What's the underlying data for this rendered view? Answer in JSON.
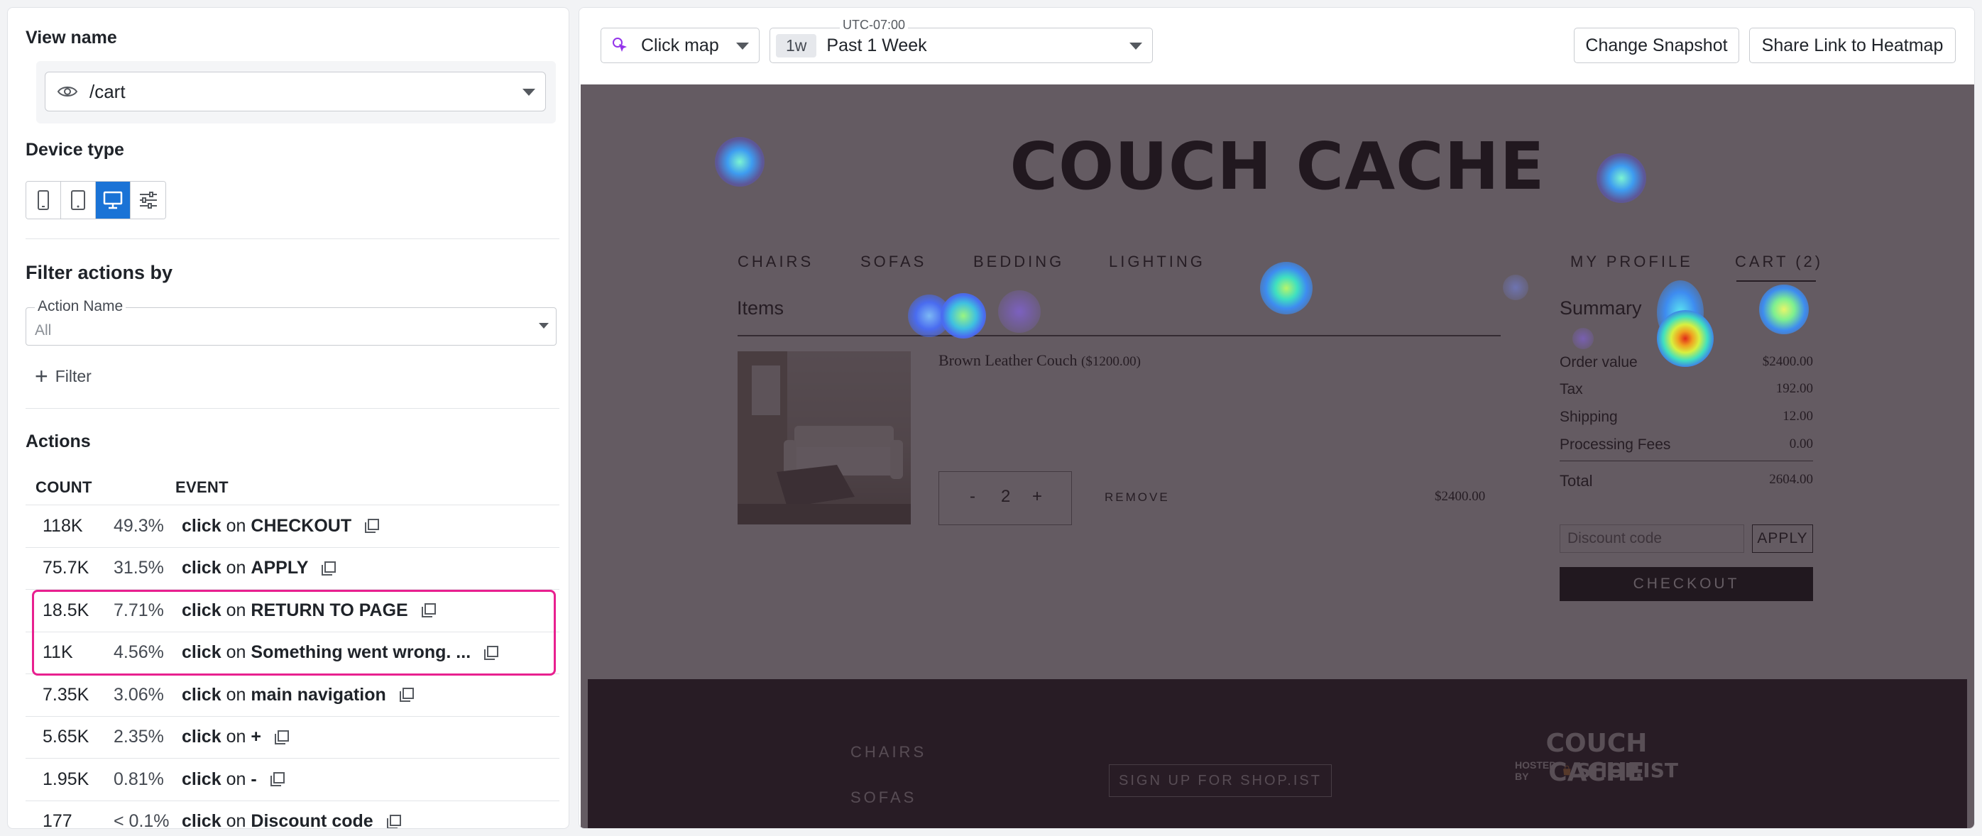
{
  "sidebar": {
    "view_name_title": "View name",
    "view_value": "/cart",
    "device_type_title": "Device type",
    "devices": [
      {
        "icon": "mobile-icon",
        "active": false
      },
      {
        "icon": "tablet-icon",
        "active": false
      },
      {
        "icon": "desktop-icon",
        "active": true
      },
      {
        "icon": "sliders-icon",
        "active": false
      }
    ],
    "filter_title": "Filter actions by",
    "action_name_label": "Action Name",
    "action_name_value": "All",
    "filter_button": "Filter",
    "actions_title": "Actions",
    "col_count": "COUNT",
    "col_event": "EVENT",
    "rows": [
      {
        "count": "118K",
        "pct": "49.3%",
        "verb": "click",
        "on": "on",
        "target": "CHECKOUT"
      },
      {
        "count": "75.7K",
        "pct": "31.5%",
        "verb": "click",
        "on": "on",
        "target": "APPLY"
      },
      {
        "count": "18.5K",
        "pct": "7.71%",
        "verb": "click",
        "on": "on",
        "target": "RETURN TO PAGE"
      },
      {
        "count": "11K",
        "pct": "4.56%",
        "verb": "click",
        "on": "on",
        "target": "Something went wrong. ..."
      },
      {
        "count": "7.35K",
        "pct": "3.06%",
        "verb": "click",
        "on": "on",
        "target": "main navigation"
      },
      {
        "count": "5.65K",
        "pct": "2.35%",
        "verb": "click",
        "on": "on",
        "target": "+"
      },
      {
        "count": "1.95K",
        "pct": "0.81%",
        "verb": "click",
        "on": "on",
        "target": "-"
      },
      {
        "count": "177",
        "pct": "< 0.1%",
        "verb": "click",
        "on": "on",
        "target": "Discount code"
      }
    ],
    "highlight_color": "#e8208f"
  },
  "toolbar": {
    "map_type": "Click map",
    "timezone": "UTC-07:00",
    "range_badge": "1w",
    "range_label": "Past 1 Week",
    "change_snapshot": "Change Snapshot",
    "share_link": "Share Link to Heatmap",
    "accent": "#1a73d6"
  },
  "site": {
    "brand": "COUCH CACHE",
    "nav_left": [
      "CHAIRS",
      "SOFAS",
      "BEDDING",
      "LIGHTING"
    ],
    "nav_right": [
      "MY PROFILE",
      "CART (2)"
    ],
    "items_heading": "Items",
    "summary_heading": "Summary",
    "product_name": "Brown Leather Couch",
    "product_price": "($1200.00)",
    "qty_minus": "-",
    "qty_value": "2",
    "qty_plus": "+",
    "remove": "REMOVE",
    "line_total": "$2400.00",
    "summary": [
      {
        "label": "Order value",
        "value": "$2400.00"
      },
      {
        "label": "Tax",
        "value": "192.00"
      },
      {
        "label": "Shipping",
        "value": "12.00"
      },
      {
        "label": "Processing Fees",
        "value": "0.00"
      }
    ],
    "total_label": "Total",
    "total_value": "2604.00",
    "discount_placeholder": "Discount code",
    "apply": "APPLY",
    "checkout": "CHECKOUT",
    "footer_links": [
      "CHAIRS",
      "SOFAS"
    ],
    "signup": "SIGN UP FOR SHOP.IST",
    "footer_brand": "COUCH CACHE",
    "hosted_by": "HOSTED BY",
    "shop_brand": "SHOP.IST"
  }
}
